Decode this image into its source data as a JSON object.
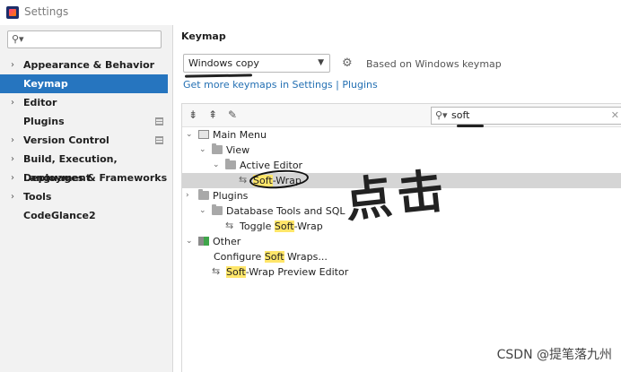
{
  "window": {
    "title": "Settings"
  },
  "sidebar": {
    "search_placeholder": "",
    "items": [
      {
        "label": "Appearance & Behavior",
        "expandable": true
      },
      {
        "label": "Keymap",
        "selected": true
      },
      {
        "label": "Editor",
        "expandable": true
      },
      {
        "label": "Plugins",
        "project_icon": true
      },
      {
        "label": "Version Control",
        "expandable": true,
        "project_icon": true
      },
      {
        "label": "Build, Execution, Deployment",
        "expandable": true
      },
      {
        "label": "Languages & Frameworks",
        "expandable": true
      },
      {
        "label": "Tools",
        "expandable": true
      },
      {
        "label": "CodeGlance2"
      }
    ]
  },
  "main": {
    "heading": "Keymap",
    "keymap_select": "Windows copy",
    "based_on": "Based on Windows keymap",
    "get_more_link": "Get more keymaps in Settings | Plugins",
    "filter_value": "soft",
    "tree": [
      {
        "pre": "",
        "hl": "",
        "post": "Main Menu",
        "level": 0,
        "expander": "v",
        "icon": "menu"
      },
      {
        "pre": "",
        "hl": "",
        "post": "View",
        "level": 1,
        "expander": "v",
        "icon": "folder"
      },
      {
        "pre": "",
        "hl": "",
        "post": "Active Editor",
        "level": 2,
        "expander": "v",
        "icon": "folder"
      },
      {
        "pre": "",
        "hl": "Soft",
        "post": "-Wrap",
        "level": 3,
        "expander": "",
        "icon": "wrap",
        "selected": true
      },
      {
        "pre": "",
        "hl": "",
        "post": "Plugins",
        "level": 0,
        "expander": ">",
        "icon": "folder"
      },
      {
        "pre": "",
        "hl": "",
        "post": "Database Tools and SQL",
        "level": 1,
        "expander": "v",
        "icon": "folder"
      },
      {
        "pre": "Toggle ",
        "hl": "Soft",
        "post": "-Wrap",
        "level": 2,
        "expander": "",
        "icon": "wrap"
      },
      {
        "pre": "",
        "hl": "",
        "post": "Other",
        "level": 0,
        "expander": "v",
        "icon": "other"
      },
      {
        "pre": "Configure ",
        "hl": "Soft",
        "post": " Wraps...",
        "level": 1,
        "expander": "",
        "icon": "none"
      },
      {
        "pre": "",
        "hl": "Soft",
        "post": "-Wrap Preview Editor",
        "level": 1,
        "expander": "",
        "icon": "wrap"
      }
    ]
  },
  "annotation": {
    "handwritten": "点击"
  },
  "watermark": "CSDN @提笔落九州",
  "colors": {
    "selection": "#2675bf",
    "highlight": "#ffe66a",
    "link": "#2470b3"
  }
}
